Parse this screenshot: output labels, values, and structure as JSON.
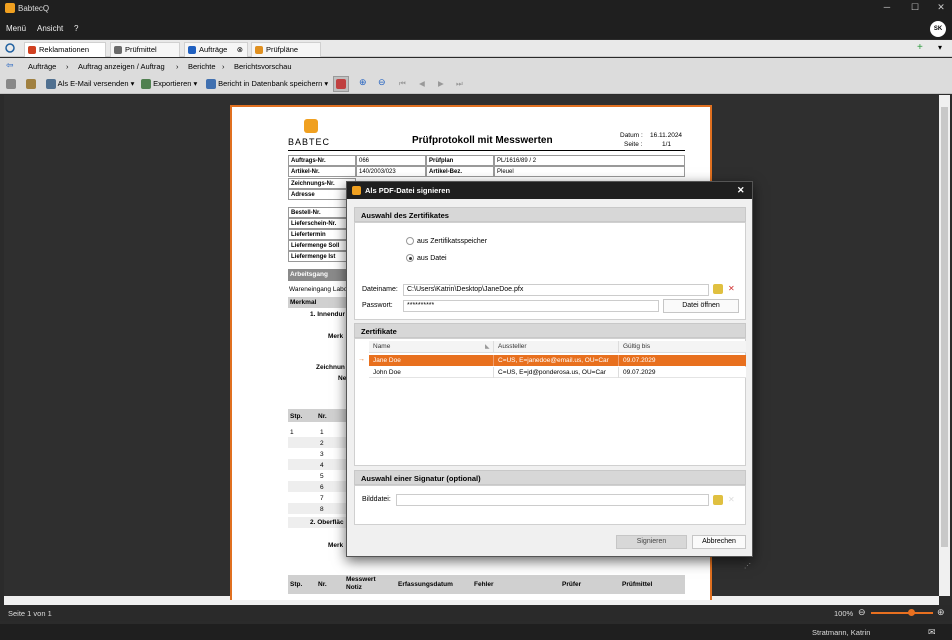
{
  "app": {
    "title": "BabtecQ"
  },
  "menu": {
    "items": [
      "Menü",
      "Ansicht",
      "?"
    ],
    "avatar": "SK"
  },
  "tabs": [
    {
      "label": "Reklamationen",
      "color": "#d04020"
    },
    {
      "label": "Prüfmittel",
      "color": "#6a6a6a"
    },
    {
      "label": "Aufträge",
      "color": "#2060c0"
    },
    {
      "label": "Prüfpläne",
      "color": "#e09020"
    }
  ],
  "breadcrumb": [
    "Aufträge",
    "Auftrag anzeigen / Auftrag",
    "Berichte",
    "Berichtsvorschau"
  ],
  "toolbar": {
    "email": "Als E-Mail versenden",
    "export": "Exportieren",
    "save_db": "Bericht in Datenbank speichern"
  },
  "report": {
    "logo": "BABTEC",
    "title": "Prüfprotokoll mit Messwerten",
    "datum_label": "Datum :",
    "datum_value": "16.11.2024",
    "seite_label": "Seite :",
    "seite_value": "1/1",
    "rows": [
      {
        "label": "Auftrags-Nr.",
        "value": "066",
        "label2": "Prüfplan",
        "value2": "PL/1616/89 / 2"
      },
      {
        "label": "Artikel-Nr.",
        "value": "140/2003/023",
        "label2": "Artikel-Bez.",
        "value2": "Pleuel"
      },
      {
        "label": "Zeichnungs-Nr.",
        "value": "",
        "label2": "",
        "value2": ""
      },
      {
        "label": "Adresse",
        "value": "",
        "label2": "",
        "value2": ""
      }
    ],
    "rows2": [
      "Bestell-Nr.",
      "Lieferschein-Nr.",
      "Liefertermin",
      "Liefermenge Soll",
      "Liefermenge Ist"
    ],
    "arbeitsgang": "Arbeitsgang",
    "wareneingang": "Wareneingang Labo",
    "merkmal": "Merkmal",
    "section1": "1. Innendur",
    "merk": "Merk",
    "zeichnun": "Zeichnun",
    "ne": "Ne",
    "stp": "Stp.",
    "nr": "Nr.",
    "stp_rows": [
      "1",
      "2",
      "3",
      "4",
      "5",
      "6",
      "7",
      "8"
    ],
    "stp1": "1",
    "section2": "2. Oberfläc",
    "merk2": "Merk",
    "footer_cols": [
      "Stp.",
      "Nr.",
      "Messwert Notiz",
      "Erfassungsdatum",
      "Fehler",
      "Prüfer",
      "Prüfmittel"
    ]
  },
  "dialog": {
    "title": "Als PDF-Datei signieren",
    "sect_cert": "Auswahl des Zertifikates",
    "radio_store": "aus Zertifikatsspeicher",
    "radio_file": "aus Datei",
    "dateiname_label": "Dateiname:",
    "dateiname_value": "C:\\Users\\Katrin\\Desktop\\JaneDoe.pfx",
    "passwort_label": "Passwort:",
    "passwort_value": "**********",
    "open_file": "Datei öffnen",
    "sect_certs": "Zertifikate",
    "grid_headers": [
      "Name",
      "Aussteller",
      "Gültig bis"
    ],
    "grid_rows": [
      {
        "name": "Jane Doe",
        "issuer": "C=US, E=janedoe@email.us, OU=Car",
        "valid": "09.07.2029",
        "selected": true
      },
      {
        "name": "John Doe",
        "issuer": "C=US, E=jd@ponderosa.us, OU=Car",
        "valid": "09.07.2029",
        "selected": false
      }
    ],
    "sect_sig": "Auswahl einer Signatur (optional)",
    "bilddatei_label": "Bilddatei:",
    "bilddatei_value": "",
    "sign": "Signieren",
    "cancel": "Abbrechen"
  },
  "status": {
    "page": "Seite 1 von 1",
    "zoom": "100%",
    "zoom_level": 0.66,
    "user": "Stratmann, Katrin"
  },
  "colors": {
    "accent": "#e87020",
    "selected_row": "#e8701e"
  }
}
